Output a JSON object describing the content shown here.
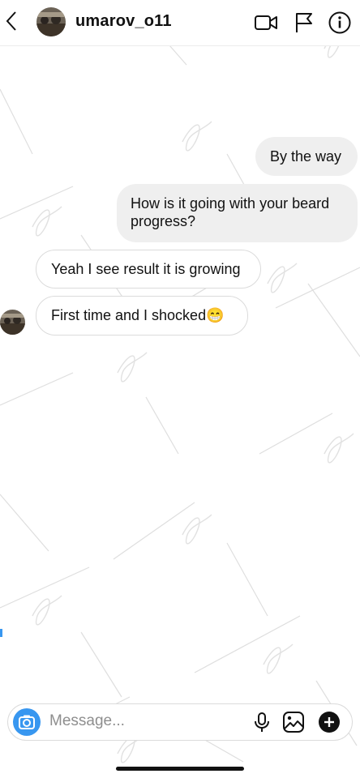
{
  "header": {
    "username": "umarov_o11",
    "icons": [
      "back-chevron-icon",
      "video-camera-icon",
      "flag-icon",
      "info-icon"
    ]
  },
  "messages": [
    {
      "direction": "outgoing",
      "text": "By the way"
    },
    {
      "direction": "outgoing",
      "text": "How is it going with your beard progress?"
    },
    {
      "direction": "incoming",
      "text": "Yeah I see result it is growing"
    },
    {
      "direction": "incoming",
      "text": "First time and I shocked😁"
    }
  ],
  "composer": {
    "placeholder": "Message...",
    "icons": [
      "camera-icon",
      "microphone-icon",
      "gallery-icon",
      "plus-icon"
    ]
  },
  "colors": {
    "accent": "#3897f0",
    "outgoing_bubble": "#efefef",
    "border": "#dbdbdb"
  }
}
